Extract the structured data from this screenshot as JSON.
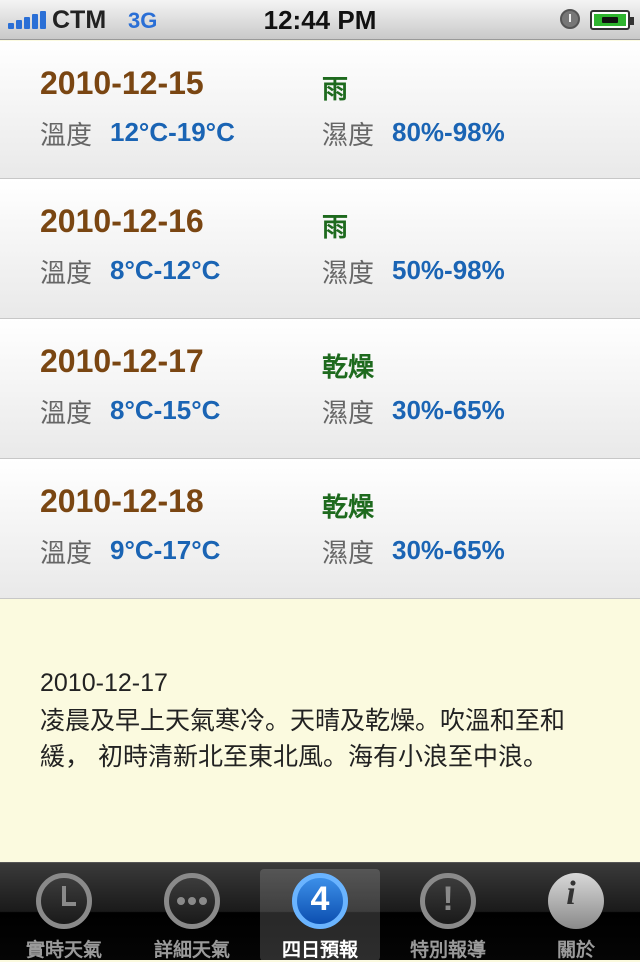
{
  "status_bar": {
    "carrier": "CTM",
    "network": "3G",
    "time": "12:44 PM",
    "signal_bars": 5,
    "battery": "charging"
  },
  "forecast": [
    {
      "date": "2010-12-15",
      "condition": "雨",
      "temp_label": "溫度",
      "temp": "12°C-19°C",
      "humidity_label": "濕度",
      "humidity": "80%-98%"
    },
    {
      "date": "2010-12-16",
      "condition": "雨",
      "temp_label": "溫度",
      "temp": "8°C-12°C",
      "humidity_label": "濕度",
      "humidity": "50%-98%"
    },
    {
      "date": "2010-12-17",
      "condition": "乾燥",
      "temp_label": "溫度",
      "temp": "8°C-15°C",
      "humidity_label": "濕度",
      "humidity": "30%-65%"
    },
    {
      "date": "2010-12-18",
      "condition": "乾燥",
      "temp_label": "溫度",
      "temp": "9°C-17°C",
      "humidity_label": "濕度",
      "humidity": "30%-65%"
    }
  ],
  "detail": {
    "date": "2010-12-17",
    "text": "凌晨及早上天氣寒冷。天晴及乾燥。吹溫和至和緩， 初時清新北至東北風。海有小浪至中浪。"
  },
  "tabs": [
    {
      "label": "實時天氣",
      "icon": "clock-icon",
      "active": false
    },
    {
      "label": "詳細天氣",
      "icon": "more-icon",
      "active": false
    },
    {
      "label": "四日預報",
      "icon": "four-icon",
      "glyph": "4",
      "active": true
    },
    {
      "label": "特別報導",
      "icon": "exclamation-icon",
      "glyph": "!",
      "active": false
    },
    {
      "label": "關於",
      "icon": "info-icon",
      "glyph": "i",
      "active": false
    }
  ],
  "colors": {
    "date": "#7a4612",
    "condition": "#1e6a1e",
    "value": "#1a64b4",
    "detail_bg": "#fbfadf",
    "active_tab": "#3c8fe8"
  }
}
